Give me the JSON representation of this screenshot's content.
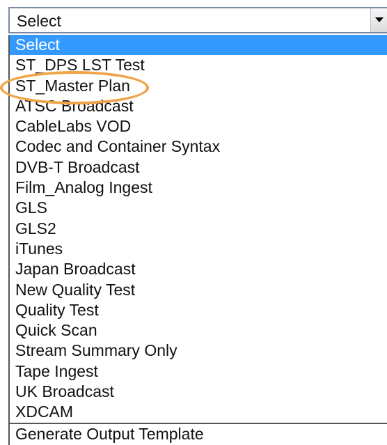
{
  "select": {
    "value": "Select"
  },
  "dropdown": {
    "options": [
      "Select",
      "ST_DPS LST Test",
      "ST_Master Plan",
      "ATSC Broadcast",
      "CableLabs VOD",
      "Codec and Container Syntax",
      "DVB-T Broadcast",
      "Film_Analog Ingest",
      "GLS",
      "GLS2",
      "iTunes",
      "Japan Broadcast",
      "New Quality Test",
      "Quality Test",
      "Quick Scan",
      "Stream Summary Only",
      "Tape Ingest",
      "UK Broadcast",
      "XDCAM"
    ],
    "footer_option": "Generate Output Template",
    "selected_index": 0
  },
  "highlight": {
    "target": "ST_Master Plan",
    "color": "#f0a447"
  },
  "colors": {
    "selection_bg": "#3399ff",
    "selection_text": "#ffffff"
  },
  "icons": {
    "dropdown_arrow": "chevron-down-icon"
  }
}
